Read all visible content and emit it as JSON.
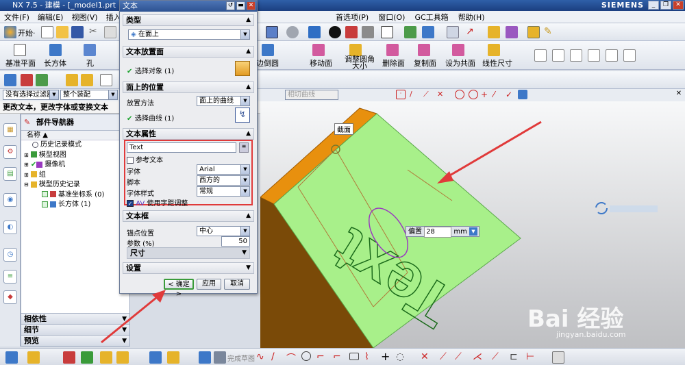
{
  "window": {
    "title": "NX 7.5 - 建模 - [_model1.prt （修改的",
    "brand": "SIEMENS"
  },
  "menu": {
    "file": "文件(F)",
    "edit": "编辑(E)",
    "view": "视图(V)",
    "insert": "插入(S",
    "prefs": "首选项(P)",
    "window": "窗口(O)",
    "gc": "GC工具箱",
    "help": "帮助(H)"
  },
  "toolbar": {
    "start": "开始·",
    "datum_plane": "基准平面",
    "block": "长方体",
    "hole": "孔",
    "chamfer": "边倒圆",
    "move_face": "移动面",
    "resize_blend": "调整圆角大小",
    "delete_face": "删除面",
    "copy_face": "复制面",
    "make_coplanar": "设为共面",
    "linear_dim": "线性尺寸"
  },
  "filters": {
    "selection_filter": "没有选择过滤器",
    "scope": "整个装配",
    "curve_rule": "相切曲线"
  },
  "status_line": "更改文本，更改字体或变换文本",
  "navigator": {
    "title": "部件导航器",
    "col_name": "名称",
    "items": [
      {
        "label": "历史记录模式"
      },
      {
        "label": "模型视图"
      },
      {
        "label": "摄像机"
      },
      {
        "label": "组"
      },
      {
        "label": "模型历史记录"
      },
      {
        "label": "基准坐标系 (0)"
      },
      {
        "label": "长方体 (1)"
      }
    ],
    "sections": {
      "dependencies": "相依性",
      "details": "细节",
      "preview": "预览"
    }
  },
  "dialog": {
    "title": "文本",
    "type_section": "类型",
    "type_value": "在面上",
    "placement_face_section": "文本放置面",
    "select_object": "选择对象 (1)",
    "position_section": "面上的位置",
    "placement_method_label": "放置方法",
    "placement_method_value": "面上的曲线",
    "select_curve": "选择曲线 (1)",
    "attributes_section": "文本属性",
    "text_value": "Text",
    "reference_text": "参考文本",
    "font_label": "字体",
    "font_value": "Arial",
    "script_label": "脚本",
    "script_value": "西方的",
    "style_label": "字体样式",
    "style_value": "常规",
    "kerning": "使用字距调整",
    "frame_section": "文本框",
    "anchor_label": "锚点位置",
    "anchor_value": "中心",
    "param_label": "参数 (%)",
    "param_value": "50",
    "size_label": "尺寸",
    "settings_section": "设置",
    "ok": "< 确定 >",
    "apply": "应用",
    "cancel": "取消"
  },
  "viewport": {
    "face_label": "截面",
    "offset_label": "偏置",
    "offset_value": "28",
    "offset_unit": "mm",
    "model_text": "Text",
    "watermark": "Bai 经验",
    "watermark_url": "jingyan.baidu.com"
  },
  "bottombar": {
    "finish_sketch": "完成草图"
  },
  "colors": {
    "face_green": "#a8f08a",
    "side_orange": "#e8900e",
    "side_brown": "#7a4a08",
    "accent_red": "#e03a3a",
    "dialog_blue": "#2e5392"
  }
}
